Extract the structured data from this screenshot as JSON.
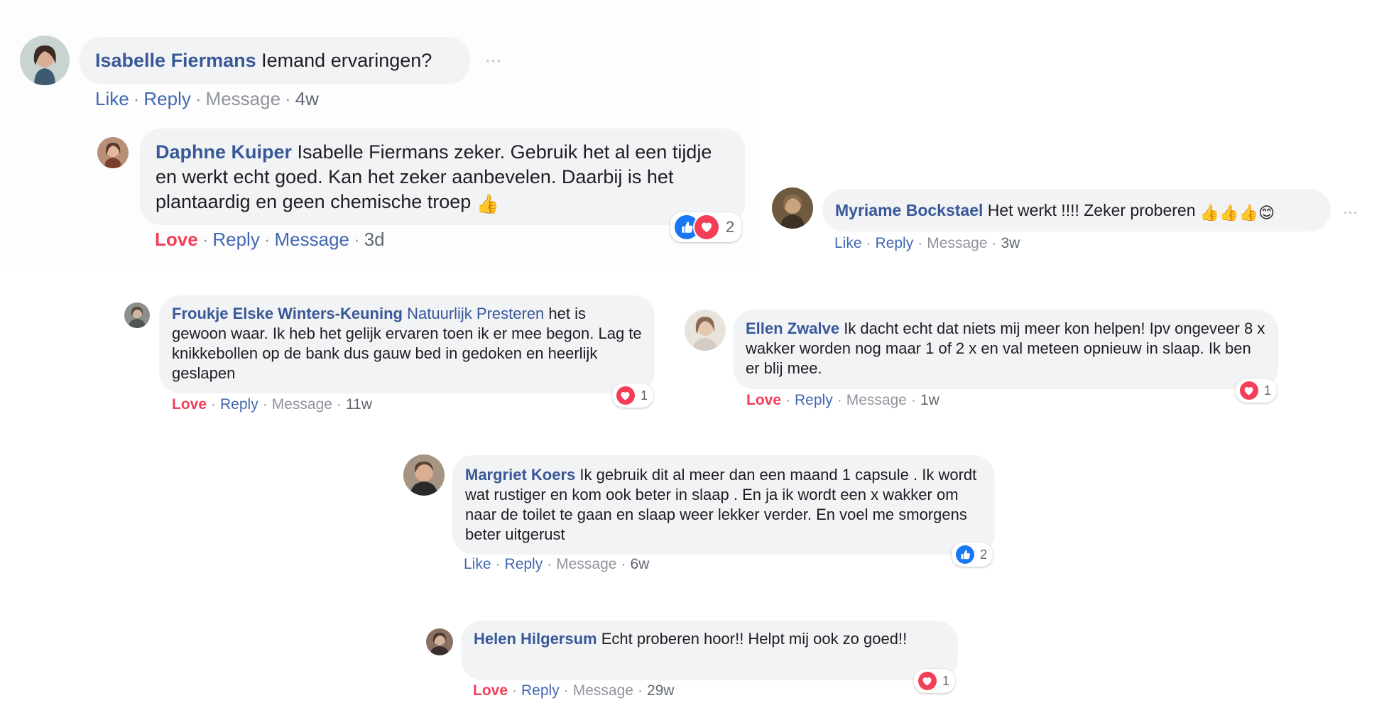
{
  "colors": {
    "link": "#385898",
    "action_link": "#4267b2",
    "love": "#f33e58",
    "like": "#1877f2",
    "meta_gray": "#90949c",
    "bubble_bg": "#f2f3f5"
  },
  "labels": {
    "like": "Like",
    "love": "Love",
    "reply": "Reply",
    "message": "Message",
    "separator": "·",
    "more": "···"
  },
  "comments": [
    {
      "author": "Isabelle Fiermans",
      "text": "Iemand ervaringen?",
      "reaction_label": "Like",
      "time": "4w",
      "avatar_icon": "profile-photo"
    },
    {
      "author": "Daphne Kuiper",
      "text": "Isabelle Fiermans zeker. Gebruik het al een tijdje en werkt echt goed. Kan het zeker aanbevelen. Daarbij is het plantaardig en geen chemische troep",
      "emoji": "👍",
      "reaction_label": "Love",
      "time": "3d",
      "reactions": {
        "icons": [
          "like",
          "love"
        ],
        "count": "2"
      }
    },
    {
      "author": "Myriame Bockstael",
      "text": "Het werkt !!!! Zeker proberen",
      "emoji": "👍👍👍😊",
      "reaction_label": "Like",
      "time": "3w"
    },
    {
      "author": "Froukje Elske Winters-Keuning",
      "tagged": "Natuurlijk Presteren",
      "text": "het is gewoon waar. Ik heb het gelijk ervaren toen ik er mee begon. Lag te knikkebollen op de bank dus gauw bed in gedoken en heerlijk geslapen",
      "reaction_label": "Love",
      "time": "11w",
      "reactions": {
        "icons": [
          "love"
        ],
        "count": "1"
      }
    },
    {
      "author": "Ellen Zwalve",
      "text": "Ik dacht echt dat niets mij meer kon helpen! Ipv ongeveer 8 x wakker worden nog maar 1 of 2 x en val meteen opnieuw in slaap. Ik ben er blij mee.",
      "reaction_label": "Love",
      "time": "1w",
      "reactions": {
        "icons": [
          "love"
        ],
        "count": "1"
      }
    },
    {
      "author": "Margriet Koers",
      "text": "Ik gebruik dit al meer dan een maand 1 capsule . Ik wordt wat rustiger en kom ook beter in slaap . En ja ik wordt een x wakker om naar de toilet te gaan en slaap weer lekker verder. En voel me smorgens beter uitgerust",
      "reaction_label": "Like",
      "time": "6w",
      "reactions": {
        "icons": [
          "like"
        ],
        "count": "2"
      }
    },
    {
      "author": "Helen Hilgersum",
      "text": "Echt proberen hoor!! Helpt mij ook zo goed!!",
      "reaction_label": "Love",
      "time": "29w",
      "reactions": {
        "icons": [
          "love"
        ],
        "count": "1"
      }
    }
  ]
}
